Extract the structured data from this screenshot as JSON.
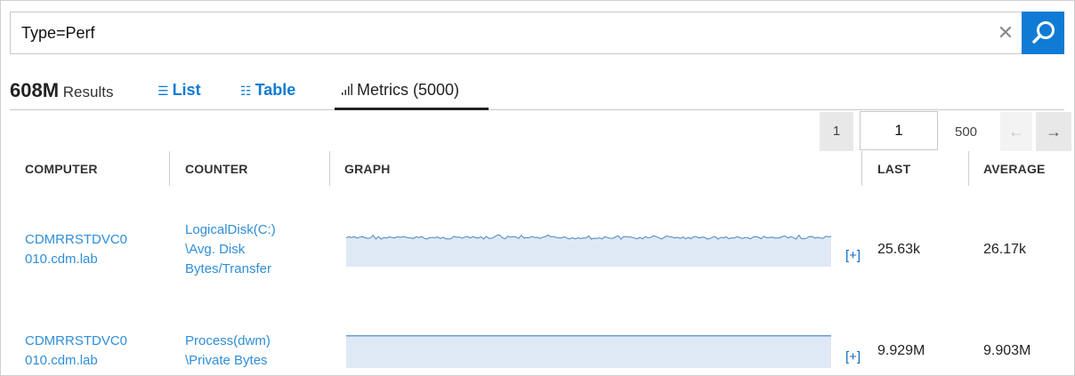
{
  "search": {
    "query": "Type=Perf"
  },
  "results": {
    "count": "608M",
    "label": "Results"
  },
  "tabs": [
    {
      "label": "List",
      "icon": "list-icon"
    },
    {
      "label": "Table",
      "icon": "table-icon"
    },
    {
      "label": "Metrics (5000)",
      "icon": "metrics-bars-icon",
      "active": true
    }
  ],
  "pager": {
    "first": "1",
    "current": "1",
    "total": "500"
  },
  "columns": [
    "COMPUTER",
    "COUNTER",
    "GRAPH",
    "LAST",
    "AVERAGE"
  ],
  "rows": [
    {
      "computer_line1": "CDMRRSTDVC0",
      "computer_line2": "010.cdm.lab",
      "counter_line1": "LogicalDisk(C:)",
      "counter_line2": "\\Avg. Disk",
      "counter_line3": "Bytes/Transfer",
      "expand": "[+]",
      "last": "25.63k",
      "average": "26.17k"
    },
    {
      "computer_line1": "CDMRRSTDVC0",
      "computer_line2": "010.cdm.lab",
      "counter_line1": "Process(dwm)",
      "counter_line2": "\\Private Bytes",
      "expand": "[+]",
      "last": "9.929M",
      "average": "9.903M"
    }
  ],
  "colors": {
    "accent": "#0f7bd4",
    "link": "#2f8ed9",
    "graph_fill": "#dfe9f5",
    "graph_line": "#4a86c0"
  }
}
